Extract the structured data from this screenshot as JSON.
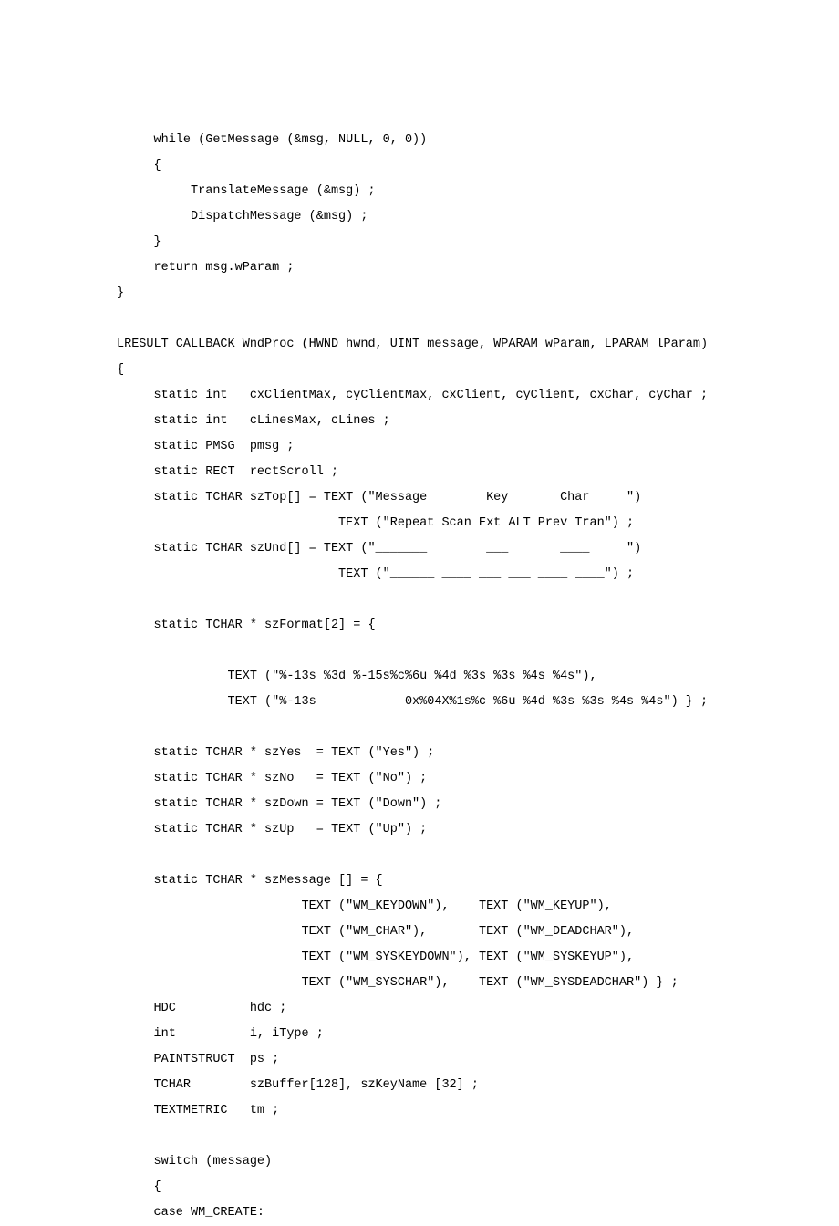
{
  "code_lines": [
    "     while (GetMessage (&msg, NULL, 0, 0))",
    "     {",
    "          TranslateMessage (&msg) ;",
    "          DispatchMessage (&msg) ;",
    "     }",
    "     return msg.wParam ;",
    "}",
    "",
    "LRESULT CALLBACK WndProc (HWND hwnd, UINT message, WPARAM wParam, LPARAM lParam)",
    "{",
    "     static int   cxClientMax, cyClientMax, cxClient, cyClient, cxChar, cyChar ;",
    "     static int   cLinesMax, cLines ;",
    "     static PMSG  pmsg ;",
    "     static RECT  rectScroll ;",
    "     static TCHAR szTop[] = TEXT (\"Message        Key       Char     \")",
    "                              TEXT (\"Repeat Scan Ext ALT Prev Tran\") ;",
    "     static TCHAR szUnd[] = TEXT (\"_______        ___       ____     \")",
    "                              TEXT (\"______ ____ ___ ___ ____ ____\") ;",
    "",
    "     static TCHAR * szFormat[2] = {",
    "",
    "               TEXT (\"%-13s %3d %-15s%c%6u %4d %3s %3s %4s %4s\"),",
    "               TEXT (\"%-13s            0x%04X%1s%c %6u %4d %3s %3s %4s %4s\") } ;",
    "",
    "     static TCHAR * szYes  = TEXT (\"Yes\") ;",
    "     static TCHAR * szNo   = TEXT (\"No\") ;",
    "     static TCHAR * szDown = TEXT (\"Down\") ;",
    "     static TCHAR * szUp   = TEXT (\"Up\") ;",
    "",
    "     static TCHAR * szMessage [] = {",
    "                         TEXT (\"WM_KEYDOWN\"),    TEXT (\"WM_KEYUP\"),",
    "                         TEXT (\"WM_CHAR\"),       TEXT (\"WM_DEADCHAR\"),",
    "                         TEXT (\"WM_SYSKEYDOWN\"), TEXT (\"WM_SYSKEYUP\"),",
    "                         TEXT (\"WM_SYSCHAR\"),    TEXT (\"WM_SYSDEADCHAR\") } ;",
    "     HDC          hdc ;",
    "     int          i, iType ;",
    "     PAINTSTRUCT  ps ;",
    "     TCHAR        szBuffer[128], szKeyName [32] ;",
    "     TEXTMETRIC   tm ;",
    "",
    "     switch (message)",
    "     {",
    "     case WM_CREATE:"
  ]
}
